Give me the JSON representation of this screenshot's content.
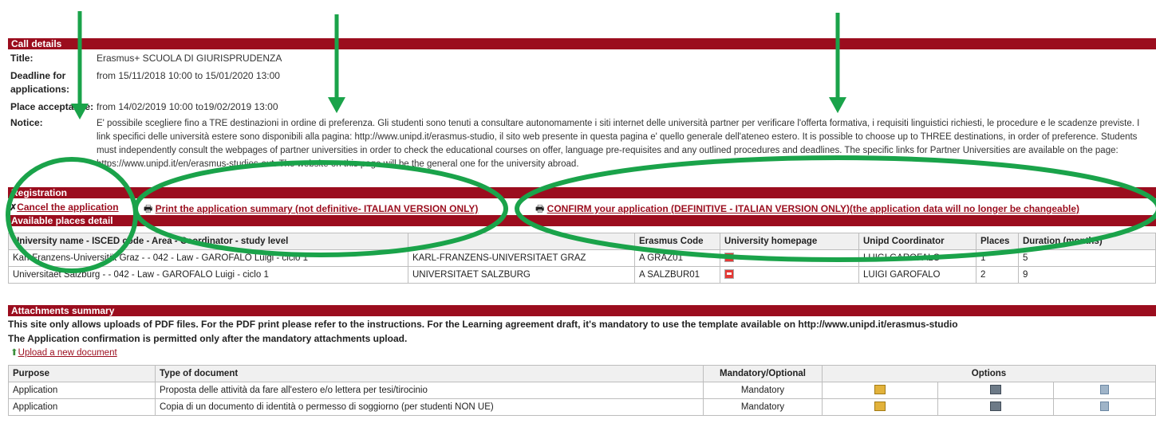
{
  "call_details": {
    "header": "Call details",
    "title_label": "Title:",
    "title_value": "Erasmus+ SCUOLA DI GIURISPRUDENZA",
    "deadline_label_1": "Deadline for",
    "deadline_label_2": "applications:",
    "deadline_value": "from 15/11/2018 10:00 to 15/01/2020 13:00",
    "place_label": "Place acceptance:",
    "place_value": "from 14/02/2019 10:00 to19/02/2019 13:00",
    "notice_label": "Notice:",
    "notice_text": "E' possibile scegliere fino a TRE destinazioni in ordine di preferenza. Gli studenti sono tenuti a consultare autonomamente i siti internet delle università partner per verificare l'offerta formativa, i requisiti linguistici richiesti, le procedure e le scadenze previste. I link specifici delle università estere sono disponibili alla pagina: http://www.unipd.it/erasmus-studio, il sito web presente in questa pagina e' quello generale dell'ateneo estero. It is possible to choose up to THREE destinations, in order of preference. Students must independently consult the webpages of partner universities in order to check the educational courses on offer, language pre-requisites and any outlined procedures and deadlines. The specific links for Partner Universities are available on the page: https://www.unipd.it/en/erasmus-studies-out. The website on this page will be the general one for the university abroad."
  },
  "registration": {
    "header": "Registration",
    "cancel": "Cancel the application",
    "print": "Print the application summary (not definitive- ITALIAN VERSION ONLY)",
    "confirm": "CONFIRM your application (DEFINITIVE - ITALIAN VERSION ONLY)(the application data will no longer be changeable)"
  },
  "places": {
    "header": "Available places detail",
    "columns": [
      "University name - ISCED code - Area - Coordinator - study level",
      "",
      "Erasmus Code",
      "University homepage",
      "Unipd Coordinator",
      "Places",
      "Duration (months)"
    ],
    "rows": [
      [
        "Karl-Franzens-Universität Graz - - 042 - Law - GAROFALO Luigi - ciclo 1",
        "KARL-FRANZENS-UNIVERSITAET GRAZ",
        "A GRAZ01",
        "",
        "LUIGI GAROFALO",
        "1",
        "5"
      ],
      [
        "Universitaet Salzburg - - 042 - Law - GAROFALO Luigi - ciclo 1",
        "UNIVERSITAET SALZBURG",
        "A SALZBUR01",
        "",
        "LUIGI GAROFALO",
        "2",
        "9"
      ]
    ]
  },
  "attachments": {
    "header": "Attachments summary",
    "info_1": "This site only allows uploads of PDF files. For the PDF print please refer to the instructions. For the Learning agreement draft, it's mandatory to use the template available on http://www.unipd.it/erasmus-studio",
    "info_2": "The Application confirmation is permitted only after the mandatory attachments upload.",
    "upload": "Upload a new document",
    "columns": [
      "Purpose",
      "Type of document",
      "Mandatory/Optional",
      "Options"
    ],
    "rows": [
      [
        "Application",
        "Proposta delle attività da fare all'estero e/o lettera per tesi/tirocinio",
        "Mandatory"
      ],
      [
        "Application",
        "Copia di un documento di identità o permesso di soggiorno (per studenti NON UE)",
        "Mandatory"
      ]
    ]
  },
  "annotation_color": "#1aa34a",
  "accent_color": "#9b0d1e"
}
